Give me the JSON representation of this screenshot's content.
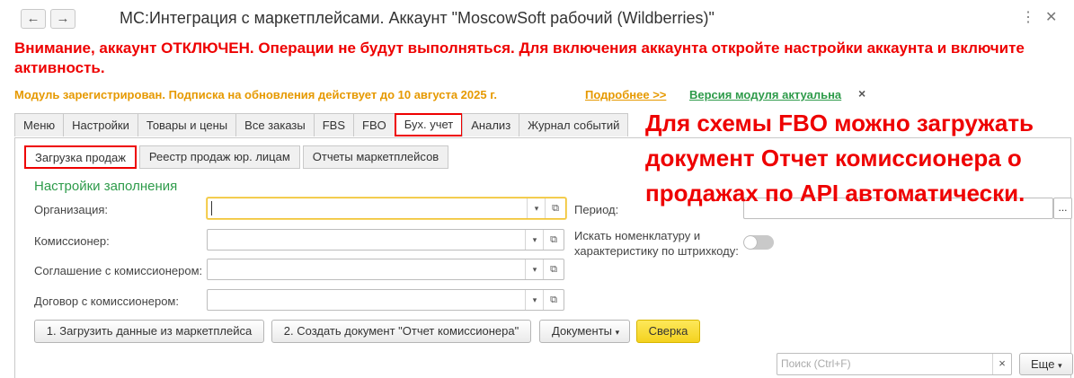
{
  "window": {
    "title": "МС:Интеграция с маркетплейсами. Аккаунт \"MoscowSoft рабочий (Wildberries)\"",
    "back_icon": "←",
    "forward_icon": "→",
    "more_icon": "⋮",
    "close_icon": "✕"
  },
  "warning": "Внимание, аккаунт ОТКЛЮЧЕН. Операции не будут выполняться. Для включения аккаунта откройте настройки аккаунта и включите активность.",
  "module": {
    "status": "Модуль зарегистрирован. Подписка на обновления действует до 10 августа 2025 г.",
    "more_link": "Подробнее >>",
    "version": "Версия модуля актуальна",
    "dismiss": "×"
  },
  "tabs": [
    "Меню",
    "Настройки",
    "Товары и цены",
    "Все заказы",
    "FBS",
    "FBO",
    "Бух. учет",
    "Анализ",
    "Журнал событий"
  ],
  "subtabs": [
    "Загрузка продаж",
    "Реестр продаж юр. лицам",
    "Отчеты маркетплейсов"
  ],
  "form": {
    "section": "Настройки заполнения",
    "org_label": "Организация:",
    "commissioner_label": "Комиссионер:",
    "agreement_label": "Соглашение с комиссионером:",
    "contract_label": "Договор с комиссионером:",
    "period_label": "Период:",
    "barcode_label_1": "Искать номенклатуру и",
    "barcode_label_2": "характеристику по штрихкоду:",
    "period_button": "..."
  },
  "buttons": {
    "load": "1. Загрузить данные из маркетплейса",
    "create": "2. Создать документ \"Отчет комиссионера\"",
    "documents": "Документы",
    "reconcile": "Сверка",
    "more": "Еще"
  },
  "search": {
    "placeholder": "Поиск (Ctrl+F)",
    "clear": "×"
  },
  "annotation": [
    "Для схемы FBO можно загружать",
    "документ Отчет комиссионера о",
    "продажах по API автоматически."
  ],
  "colors": {
    "alert": "#e00000",
    "module_status": "#e69900",
    "link": "#e69900",
    "version": "#2e9b4a",
    "section": "#2e9b4a"
  }
}
